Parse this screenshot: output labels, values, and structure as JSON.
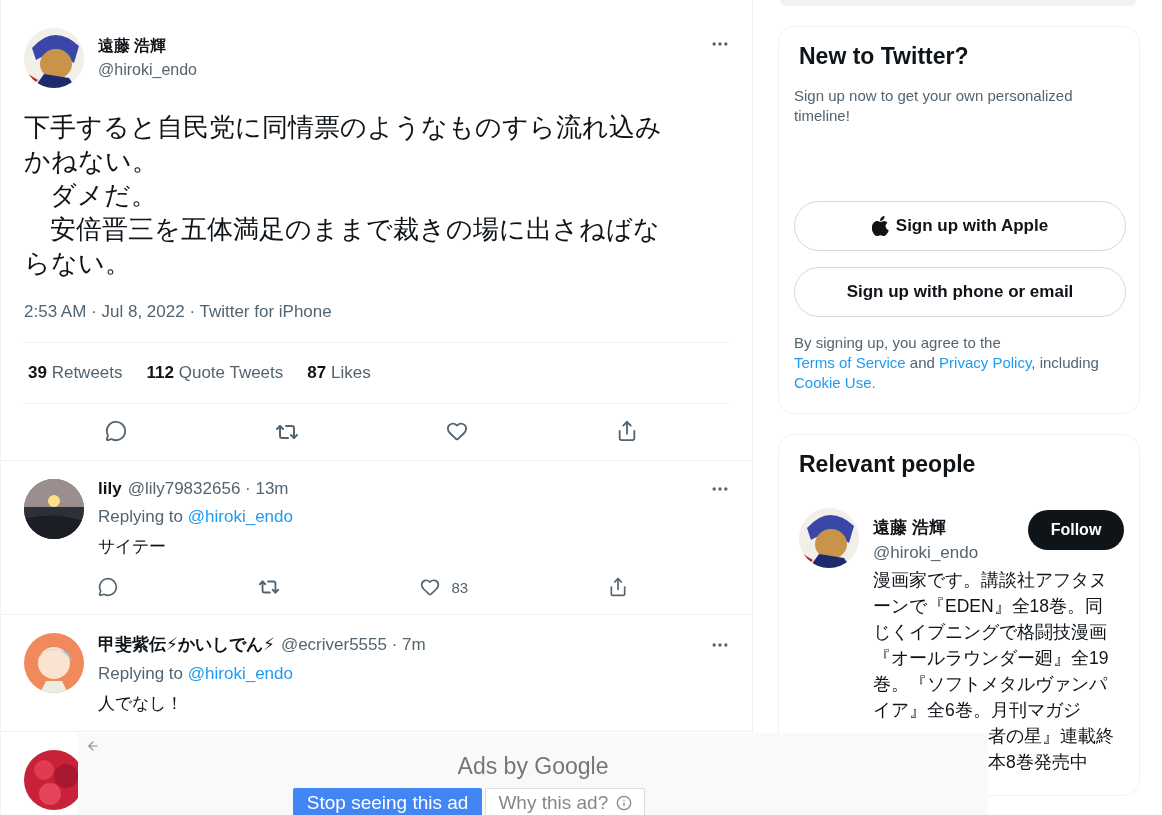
{
  "tweet": {
    "author": {
      "name": "遠藤 浩輝",
      "handle": "@hiroki_endo"
    },
    "paragraphs": [
      "下手すると自民党に同情票のようなものすら流れ込みかねない。",
      "　ダメだ。",
      "　安倍晋三を五体満足のままで裁きの場に出さねばならない。"
    ],
    "meta": "2:53 AM · Jul 8, 2022 · Twitter for iPhone",
    "stats": [
      {
        "count": "39",
        "label": "Retweets"
      },
      {
        "count": "112",
        "label": "Quote Tweets"
      },
      {
        "count": "87",
        "label": "Likes"
      }
    ]
  },
  "replies": [
    {
      "name": "lily",
      "handle": "@lily79832656 · 13m",
      "replying_label": "Replying to",
      "replying_to": "@hiroki_endo",
      "text": "サイテー",
      "like_count": "83",
      "show_actions": true,
      "avatar": {
        "kind": "picture"
      }
    },
    {
      "name": "甲斐紫伝⚡かいしでん⚡",
      "handle": "@ecriver5555 · 7m",
      "replying_label": "Replying to",
      "replying_to": "@hiroki_endo",
      "text": "人でなし！",
      "avatar": {
        "kind": "picture"
      }
    },
    {
      "avatar": {
        "kind": "picture"
      }
    }
  ],
  "signup": {
    "title": "New to Twitter?",
    "subtitle": "Sign up now to get your own personalized timeline!",
    "buttons": [
      {
        "label": "Sign up with Apple",
        "kind": "apple"
      },
      {
        "label": "Sign up with phone or email",
        "kind": "plain"
      }
    ],
    "legal": [
      {
        "text": "By signing up, you agree to the "
      },
      {
        "text": "Terms of Service",
        "link": true
      },
      {
        "text": " and "
      },
      {
        "text": "Privacy Policy",
        "link": true
      },
      {
        "text": ", including "
      },
      {
        "text": "Cookie Use.",
        "link": true
      }
    ]
  },
  "relevant_people": {
    "title": "Relevant people",
    "person": {
      "name": "遠藤 浩輝",
      "handle": "@hiroki_endo",
      "follow": "Follow",
      "bio_lines": [
        "漫画家です。講談社アフタヌ",
        "ーンで『EDEN』全18巻。同",
        "じくイブニングで格闘技漫画",
        "『オールラウンダー廻』全19",
        "巻。『ソフトメタルヴァンパ",
        "イア』全6巻。月刊マガジ"
      ],
      "covered_bio_lines": [
        "者の星』連載終",
        "本8巻発売中"
      ]
    }
  },
  "ad": {
    "label": "Ads by Google",
    "stop": "Stop seeing this ad",
    "why": "Why this ad?"
  }
}
